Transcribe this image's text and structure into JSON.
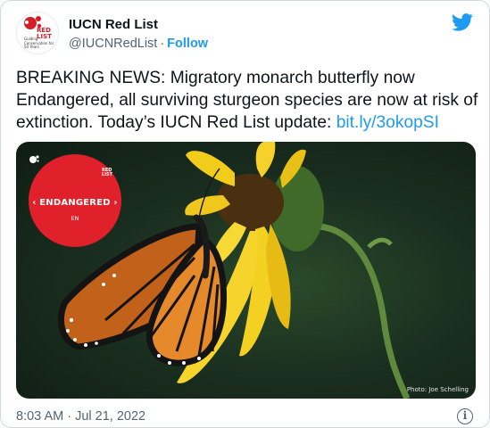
{
  "account": {
    "name": "IUCN Red List",
    "handle": "@IUCNRedList",
    "separator": "·",
    "follow_label": "Follow",
    "avatar_icon": "iucn-red-list-logo",
    "avatar_text": "RED LIST",
    "avatar_subtext": "Guiding Conservation for 50 Years"
  },
  "tweet": {
    "text": "BREAKING NEWS: Migratory monarch butterfly now Endangered, all surviving sturgeon species are now at risk of extinction. Today’s IUCN Red List update: ",
    "link": "bit.ly/3okopSI",
    "timestamp": "8:03 AM · Jul 21, 2022"
  },
  "media": {
    "badge_logo_text": "RED LIST",
    "badge_label": "‹ ENDANGERED ›",
    "badge_code": "EN",
    "credit": "Photo: Joe Schelling",
    "badge_color": "#e0202a"
  },
  "colors": {
    "accent": "#1d9bf0",
    "text": "#0f1419",
    "muted": "#536471"
  },
  "icons": {
    "brand": "twitter-bird-icon",
    "info": "info-icon"
  }
}
